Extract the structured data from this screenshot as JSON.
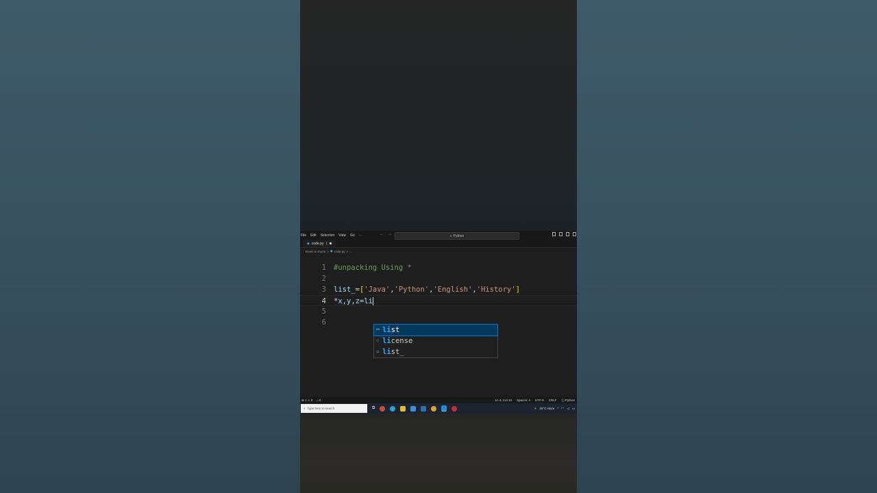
{
  "titlebar": {
    "menu": [
      "File",
      "Edit",
      "Selection",
      "View",
      "Go",
      "···"
    ],
    "nav_back": "←",
    "nav_forward": "→",
    "search_text": "Python"
  },
  "tab": {
    "filename": "code.py",
    "index_label": "1"
  },
  "breadcrumb": {
    "folder": "Reels & shorts",
    "sep": ">",
    "file": "code.py",
    "tail": "..."
  },
  "editor": {
    "lines": [
      {
        "num": "1",
        "tokens": [
          {
            "t": "#unpacking Using *",
            "c": "comment"
          }
        ]
      },
      {
        "num": "2",
        "tokens": []
      },
      {
        "num": "3",
        "tokens": [
          {
            "t": "list_",
            "c": "var"
          },
          {
            "t": "=",
            "c": "op"
          },
          {
            "t": "[",
            "c": "br"
          },
          {
            "t": "'Java'",
            "c": "str"
          },
          {
            "t": ",",
            "c": "op"
          },
          {
            "t": "'Python'",
            "c": "str"
          },
          {
            "t": ",",
            "c": "op"
          },
          {
            "t": "'English'",
            "c": "str"
          },
          {
            "t": ",",
            "c": "op"
          },
          {
            "t": "'History'",
            "c": "str"
          },
          {
            "t": "]",
            "c": "br"
          }
        ]
      },
      {
        "num": "4",
        "tokens": [
          {
            "t": "*",
            "c": "op"
          },
          {
            "t": "x",
            "c": "var"
          },
          {
            "t": ",",
            "c": "op"
          },
          {
            "t": "y",
            "c": "var"
          },
          {
            "t": ",",
            "c": "op"
          },
          {
            "t": "z",
            "c": "var"
          },
          {
            "t": "=",
            "c": "op"
          },
          {
            "t": "li",
            "c": "var"
          }
        ]
      },
      {
        "num": "5",
        "tokens": []
      },
      {
        "num": "6",
        "tokens": []
      }
    ]
  },
  "suggestions": [
    {
      "match": "li",
      "rest": "st",
      "icon": "⚯"
    },
    {
      "match": "li",
      "rest": "cense",
      "icon": "◌"
    },
    {
      "match": "li",
      "rest": "st_",
      "icon": "▭"
    }
  ],
  "status": {
    "errors": "⊗ 1 ⚠ 0",
    "ports": "⛬ 0",
    "position": "Ln 4, Col 10",
    "spaces": "Spaces: 4",
    "encoding": "UTF-8",
    "eol": "CRLF",
    "language": "{ } Python"
  },
  "taskbar": {
    "search_placeholder": "Type here to search",
    "weather": "26°C  Haze",
    "colors": {
      "bg": "#1c2430"
    }
  }
}
